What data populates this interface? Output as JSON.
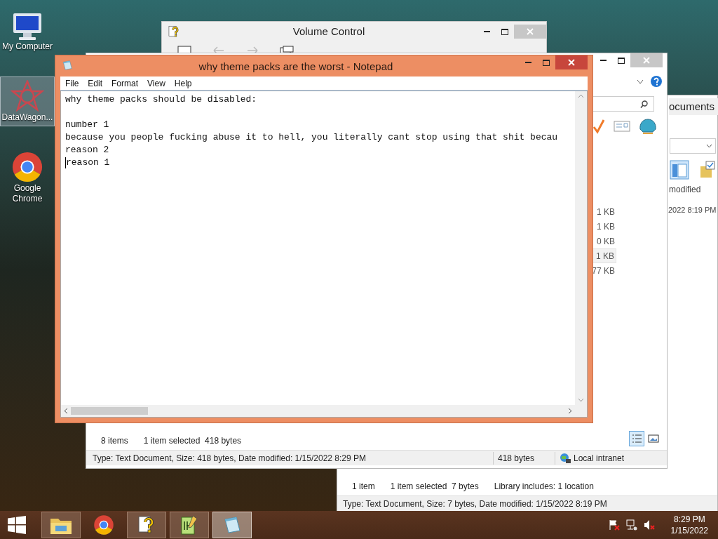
{
  "desktop_icons": [
    {
      "kind": "computer",
      "label": "My Computer",
      "selected": false
    },
    {
      "kind": "datawagon",
      "label": "DataWagon...",
      "selected": true
    },
    {
      "kind": "chrome",
      "label": "Google Chrome",
      "selected": false
    }
  ],
  "volume_window": {
    "title": "Volume Control"
  },
  "documents_window": {
    "breadcrumb": "ocuments",
    "column_header": "modified",
    "date_cell": "2022 8:19 PM",
    "status": [
      "1 item",
      "1 item selected  7 bytes",
      "Library includes: 1 location"
    ],
    "details": "Type: Text Document, Size: 7 bytes, Date modified: 1/15/2022 8:19 PM"
  },
  "explorer_window": {
    "sizes": [
      {
        "text": "1 KB",
        "selected": false
      },
      {
        "text": "1 KB",
        "selected": false
      },
      {
        "text": "0 KB",
        "selected": false
      },
      {
        "text": "1 KB",
        "selected": true
      },
      {
        "text": "77 KB",
        "selected": false
      }
    ],
    "status": [
      "8 items",
      "1 item selected  418 bytes"
    ],
    "details": "Type: Text Document, Size: 418 bytes, Date modified: 1/15/2022 8:29 PM",
    "size": "418 bytes",
    "zone": "Local intranet"
  },
  "notepad": {
    "title": "why theme packs are the worst - Notepad",
    "menu": [
      "File",
      "Edit",
      "Format",
      "View",
      "Help"
    ],
    "lines": [
      {
        "kind": "text",
        "text": "why theme packs should be disabled:"
      },
      {
        "kind": "blank"
      },
      {
        "kind": "text",
        "text": "number 1"
      },
      {
        "kind": "text",
        "text": "because you people fucking abuse it to hell, you literally cant stop using that shit becau"
      },
      {
        "kind": "text",
        "text": "reason 2"
      },
      {
        "kind": "text",
        "text": "reason 1"
      }
    ]
  },
  "taskbar": {
    "buttons": [
      {
        "kind": "explorer",
        "open": true,
        "selected": false
      },
      {
        "kind": "chrome",
        "open": false,
        "selected": false
      },
      {
        "kind": "help",
        "open": true,
        "selected": false
      },
      {
        "kind": "notepadpp",
        "open": true,
        "selected": false
      },
      {
        "kind": "notepad",
        "open": true,
        "selected": true
      }
    ],
    "time": "8:29 PM",
    "date": "1/15/2022"
  }
}
